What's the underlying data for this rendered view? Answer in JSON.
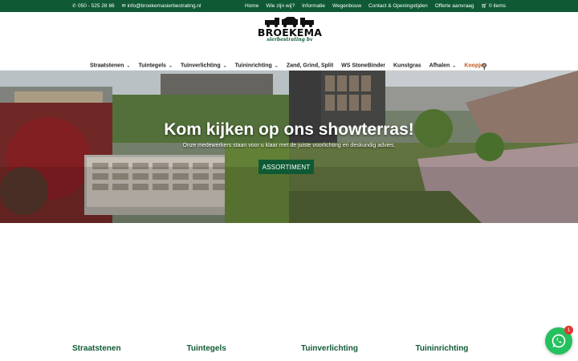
{
  "topbar": {
    "phone": "050 - 525 28 86",
    "email": "info@broekemasierbestrating.nl",
    "links": [
      "Home",
      "Wie zijn wij?",
      "Informatie",
      "Wegenbouw",
      "Contact & Openingstijden",
      "Offerte aanvraag"
    ],
    "cart": "0 items",
    "bg_color": "#0f5a35"
  },
  "logo": {
    "name": "BROEKEMA",
    "subtitle": "sierbestrating bv"
  },
  "nav": {
    "items": [
      {
        "label": "Straatstenen",
        "dropdown": true
      },
      {
        "label": "Tuintegels",
        "dropdown": true
      },
      {
        "label": "Tuinverlichting",
        "dropdown": true
      },
      {
        "label": "Tuininrichting",
        "dropdown": true
      },
      {
        "label": "Zand, Grind, Split",
        "dropdown": false
      },
      {
        "label": "WS StoneBinder",
        "dropdown": false
      },
      {
        "label": "Kunstgras",
        "dropdown": false
      },
      {
        "label": "Afhalen",
        "dropdown": true
      },
      {
        "label": "Koopjes",
        "dropdown": false,
        "active": true
      }
    ],
    "search_icon": "search-icon"
  },
  "hero": {
    "title": "Kom kijken op ons showterras!",
    "subtitle": "Onze medewerkers staan voor u klaar met de juiste voorlichting en deskundig advies.",
    "button": "ASSORTIMENT"
  },
  "categories": [
    "Straatstenen",
    "Tuintegels",
    "Tuinverlichting",
    "Tuininrichting"
  ],
  "whatsapp": {
    "badge": "1",
    "icon": "whatsapp-icon",
    "color": "#25c05f"
  },
  "colors": {
    "accent": "#0f5a35",
    "active_nav": "#c25a1e"
  }
}
